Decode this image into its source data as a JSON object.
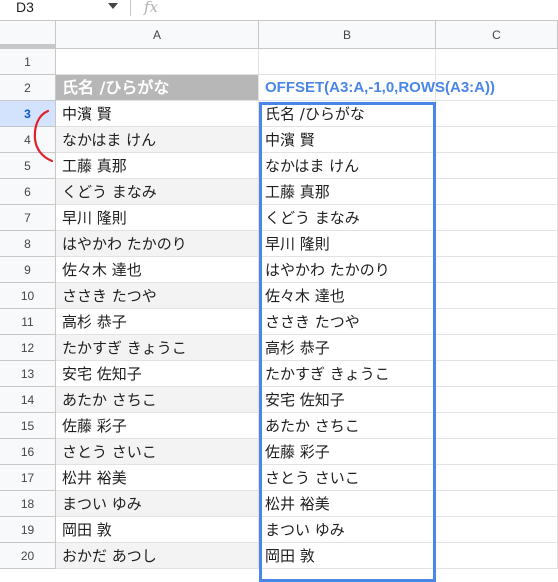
{
  "formula_bar": {
    "name_box": "D3",
    "fx_icon": "fx-icon"
  },
  "columns": [
    {
      "label": ""
    },
    {
      "label": "A"
    },
    {
      "label": "B"
    },
    {
      "label": "C"
    }
  ],
  "rows": [
    {
      "num": "1",
      "a": "",
      "b": ""
    },
    {
      "num": "2",
      "a": "氏名 /ひらがな",
      "b": "OFFSET(A3:A,-1,0,ROWS(A3:A))"
    },
    {
      "num": "3",
      "a": "中濱 賢",
      "b": "氏名 /ひらがな"
    },
    {
      "num": "4",
      "a": "なかはま けん",
      "b": "中濱 賢"
    },
    {
      "num": "5",
      "a": "工藤 真那",
      "b": "なかはま けん"
    },
    {
      "num": "6",
      "a": "くどう まなみ",
      "b": "工藤 真那"
    },
    {
      "num": "7",
      "a": "早川 隆則",
      "b": "くどう まなみ"
    },
    {
      "num": "8",
      "a": "はやかわ たかのり",
      "b": "早川 隆則"
    },
    {
      "num": "9",
      "a": "佐々木 達也",
      "b": "はやかわ たかのり"
    },
    {
      "num": "10",
      "a": "ささき たつや",
      "b": "佐々木 達也"
    },
    {
      "num": "11",
      "a": "高杉 恭子",
      "b": "ささき たつや"
    },
    {
      "num": "12",
      "a": "たかすぎ きょうこ",
      "b": "高杉 恭子"
    },
    {
      "num": "13",
      "a": "安宅 佐知子",
      "b": "たかすぎ きょうこ"
    },
    {
      "num": "14",
      "a": "あたか さちこ",
      "b": "安宅 佐知子"
    },
    {
      "num": "15",
      "a": "佐藤 彩子",
      "b": "あたか さちこ"
    },
    {
      "num": "16",
      "a": "さとう さいこ",
      "b": "佐藤 彩子"
    },
    {
      "num": "17",
      "a": "松井 裕美",
      "b": "さとう さいこ"
    },
    {
      "num": "18",
      "a": "まつい ゆみ",
      "b": "松井 裕美"
    },
    {
      "num": "19",
      "a": "岡田 敦",
      "b": "まつい ゆみ"
    },
    {
      "num": "20",
      "a": "おかだ あつし",
      "b": "岡田 敦"
    }
  ],
  "colors": {
    "selection": "#4a86e8",
    "header_fill": "#b7b7b7",
    "band_fill": "#f3f3f3",
    "annotation": "#e0202a"
  }
}
